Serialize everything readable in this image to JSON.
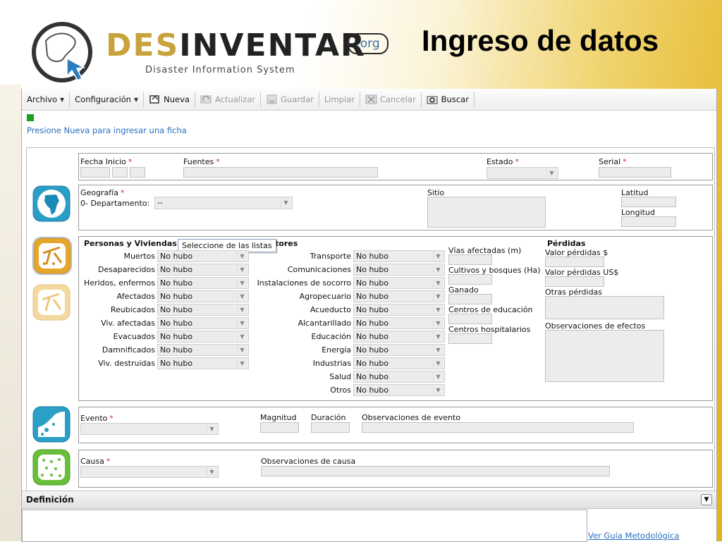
{
  "slide": {
    "title": "Ingreso de datos",
    "logo": {
      "part1": "DES",
      "part2": "INVENTAR",
      "org": ".org",
      "subtitle": "Disaster Information System"
    }
  },
  "toolbar": {
    "archivo": "Archivo",
    "configuracion": "Configuración",
    "nueva": "Nueva",
    "actualizar": "Actualizar",
    "guardar": "Guardar",
    "limpiar": "Limpiar",
    "cancelar": "Cancelar",
    "buscar": "Buscar"
  },
  "message": "Presione Nueva para ingresar una ficha",
  "header_panel": {
    "fecha_inicio": "Fecha Inicio",
    "fuentes": "Fuentes",
    "estado": "Estado",
    "serial": "Serial",
    "required_mark": "*"
  },
  "geo_panel": {
    "geografia": "Geografía",
    "departamento": "0- Departamento:",
    "departamento_value": "--",
    "sitio": "Sitio",
    "latitud": "Latitud",
    "longitud": "Longitud"
  },
  "effects_panel": {
    "personas_title": "Personas y Viviendas",
    "sectores_title_fragment": "tores",
    "perdidas_title": "Pérdidas",
    "tooltip": "Seleccione de las listas",
    "default_value": "No hubo",
    "personas": [
      "Muertos",
      "Desaparecidos",
      "Heridos, enfermos",
      "Afectados",
      "Reubicados",
      "Viv. afectadas",
      "Evacuados",
      "Damnificados",
      "Viv. destruidas"
    ],
    "sectores": [
      "Transporte",
      "Comunicaciones",
      "Instalaciones de socorro",
      "Agropecuario",
      "Acueducto",
      "Alcantarillado",
      "Educación",
      "Energía",
      "Industrias",
      "Salud",
      "Otros"
    ],
    "infra": [
      "Vías afectadas (m)",
      "Cultivos y bosques (Ha)",
      "Ganado",
      "Centros de educación",
      "Centros hospitalarios"
    ],
    "valor_perdidas": "Valor pérdidas $",
    "valor_perdidas_usd": "Valor pérdidas US$",
    "otras_perdidas": "Otras pérdidas",
    "observaciones_efectos": "Observaciones de efectos"
  },
  "event_panel": {
    "evento": "Evento",
    "magnitud": "Magnitud",
    "duracion": "Duración",
    "observaciones_evento": "Observaciones de evento"
  },
  "cause_panel": {
    "causa": "Causa",
    "observaciones_causa": "Observaciones de causa"
  },
  "definition": {
    "title": "Definición",
    "guide_link": "Ver Guía Metodológica"
  },
  "colors": {
    "accent_blue": "#2a6fbf",
    "geo_tile": "#2a9ec6",
    "effects_tile": "#e4a62c",
    "event_tile": "#2aa0c6",
    "cause_tile": "#6abf3a"
  }
}
